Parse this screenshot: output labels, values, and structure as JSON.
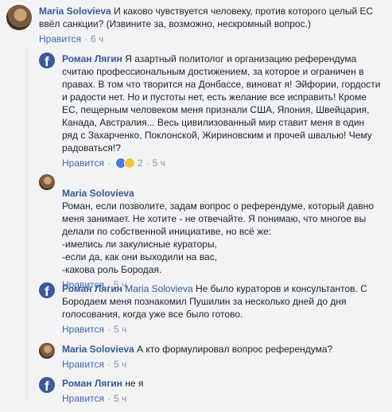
{
  "comments": [
    {
      "author": "Maria Solovieva",
      "mention": "",
      "text": "И каково чувствуется человеку, против которого целый ЕС ввёл санкции? (Извините за, возможно, нескромный вопрос.)",
      "like_label": "Нравится",
      "time": "6 ч"
    },
    {
      "author": "Роман Лягин",
      "mention": "",
      "text": "Я азартный политолог и организацию референдума считаю профессиональным достижением, за которое и ограничен в правах. В том что творится на Донбассе, виноват я! Эйфории, гордости и радости нет. Но и пустоты нет, есть желание все исправить! Кроме ЕС, пещерным человеком меня признали США, Япония, Швейцария, Канада, Австралия... Весь цивилизованный мир ставит меня в один ряд с Захарченко, Поклонской, Жириновским и прочей швалью! Чему радоваться!?",
      "like_label": "Нравится",
      "reactions_count": "2",
      "time": "5 ч"
    },
    {
      "author": "Maria Solovieva",
      "mention": "",
      "text": "Роман, если позволите, задам вопрос о референдуме, который давно меня занимает. Не хотите - не отвечайте. Я понимаю, что многое вы делали по собственной инициативе, но всё же:\n-имелись ли закулисные кураторы,\n-если да, как они выходили на вас,\n-какова роль Бородая.",
      "like_label": "Нравится",
      "time": "5 ч"
    },
    {
      "author": "Роман Лягин",
      "mention": "Maria Solovieva",
      "text": "Не было кураторов и консультантов. С Бородаем меня познакомил Пушилин за несколько дней до дня голосования, когда уже все было готово.",
      "like_label": "Нравится",
      "time": "5 ч"
    },
    {
      "author": "Maria Solovieva",
      "mention": "",
      "text": "А кто формулировал вопрос референдума?",
      "like_label": "Нравится",
      "time": "5 ч"
    },
    {
      "author": "Роман Лягин",
      "mention": "",
      "text": "не я",
      "like_label": "Нравится",
      "time": "5 ч"
    }
  ],
  "icons": {
    "facebook": "facebook-logo-icon",
    "like_reaction": "like-reaction-icon",
    "haha_reaction": "haha-reaction-icon"
  },
  "colors": {
    "link": "#385898",
    "meta": "#90949c",
    "background": "#f2f3f5",
    "facebook_blue": "#3b5998"
  }
}
